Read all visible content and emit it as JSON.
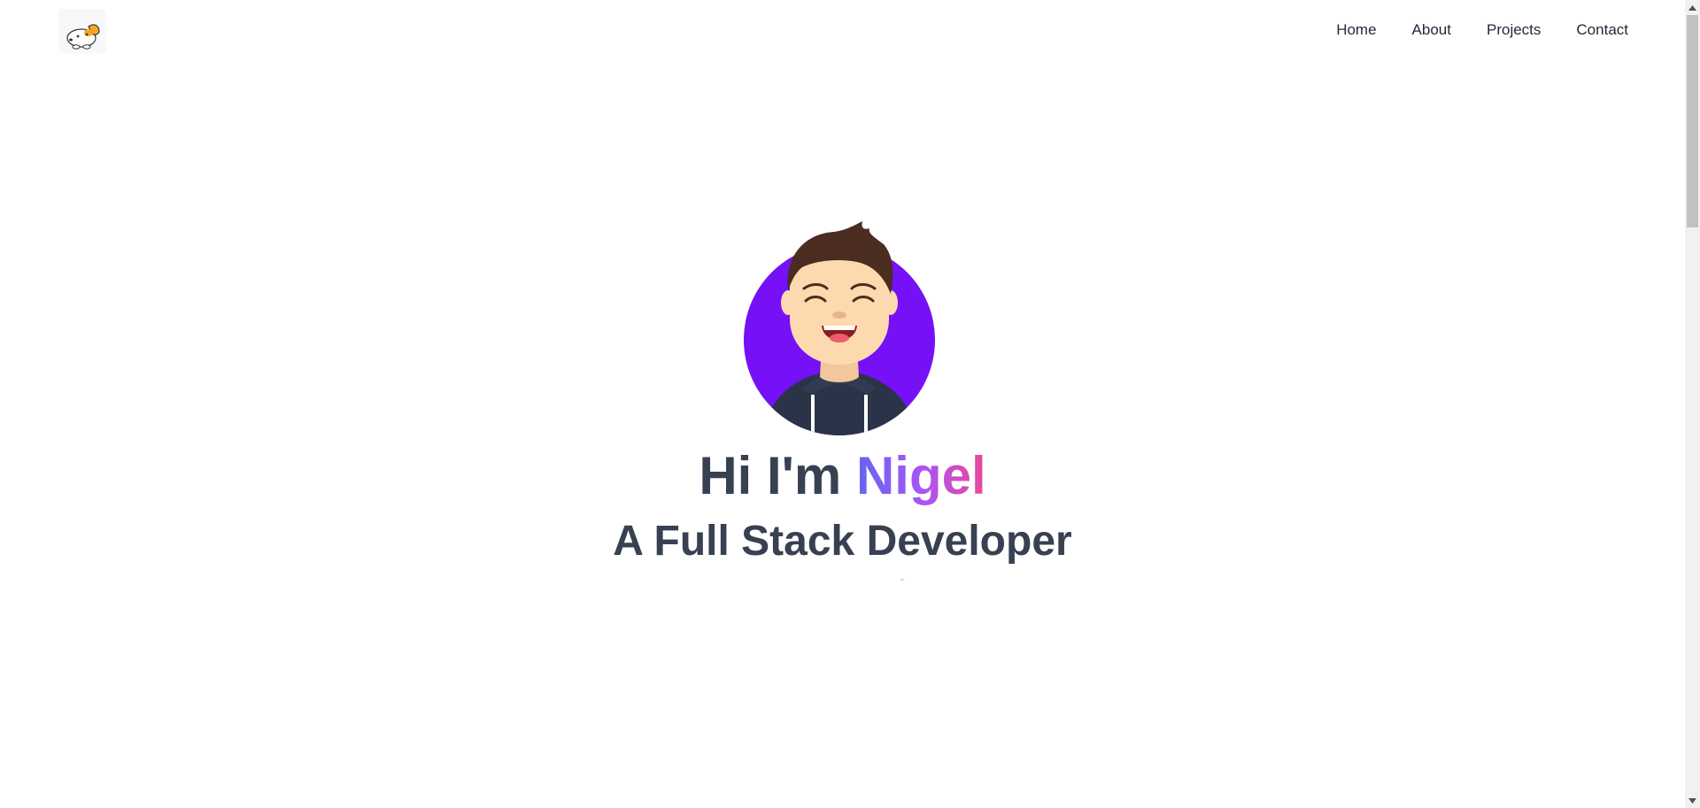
{
  "nav": {
    "logo_icon": "dog-logo-icon",
    "links": [
      {
        "label": "Home"
      },
      {
        "label": "About"
      },
      {
        "label": "Projects"
      },
      {
        "label": "Contact"
      }
    ]
  },
  "hero": {
    "avatar_icon": "developer-avatar-icon",
    "greeting_prefix": "Hi I'm ",
    "name": "Nigel",
    "subtitle": "A Full Stack Developer"
  },
  "colors": {
    "avatar_bg": "#7510f7",
    "text": "#374151",
    "gradient_start": "#6366f1",
    "gradient_mid": "#a855f7",
    "gradient_end": "#ec4899",
    "hoodie": "#2b3348",
    "skin": "#fdd9b0",
    "hair": "#4b2c20"
  }
}
